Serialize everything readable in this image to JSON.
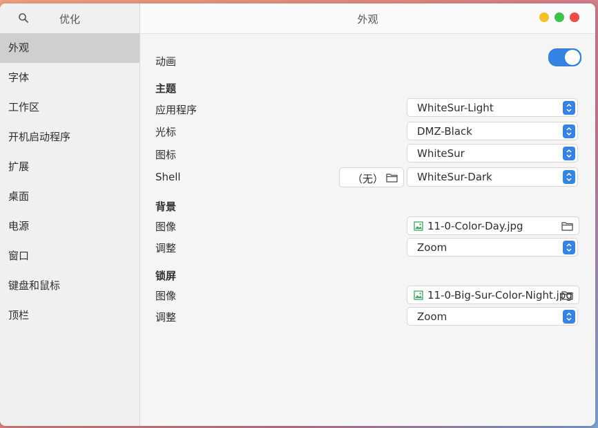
{
  "sidebar": {
    "title": "优化",
    "search_icon": "search-icon",
    "items": [
      {
        "label": "外观",
        "selected": true
      },
      {
        "label": "字体"
      },
      {
        "label": "工作区"
      },
      {
        "label": "开机启动程序"
      },
      {
        "label": "扩展"
      },
      {
        "label": "桌面"
      },
      {
        "label": "电源"
      },
      {
        "label": "窗口"
      },
      {
        "label": "键盘和鼠标"
      },
      {
        "label": "顶栏"
      }
    ]
  },
  "header": {
    "title": "外观"
  },
  "window_controls": {
    "minimize_color": "#f5c02c",
    "maximize_color": "#3ac44a",
    "close_color": "#e94d45"
  },
  "animation": {
    "label": "动画",
    "enabled": true
  },
  "theme": {
    "section_title": "主题",
    "applications": {
      "label": "应用程序",
      "value": "WhiteSur-Light"
    },
    "cursor": {
      "label": "光标",
      "value": "DMZ-Black"
    },
    "icons": {
      "label": "图标",
      "value": "WhiteSur"
    },
    "shell": {
      "label": "Shell",
      "file_button": "（无）",
      "value": "WhiteSur-Dark"
    }
  },
  "background": {
    "section_title": "背景",
    "image": {
      "label": "图像",
      "value": "11-0-Color-Day.jpg"
    },
    "adjustment": {
      "label": "调整",
      "value": "Zoom"
    }
  },
  "lock_screen": {
    "section_title": "锁屏",
    "image": {
      "label": "图像",
      "value": "11-0-Big-Sur-Color-Night.jpg"
    },
    "adjustment": {
      "label": "调整",
      "value": "Zoom"
    }
  },
  "colors": {
    "accent": "#3584e4"
  }
}
